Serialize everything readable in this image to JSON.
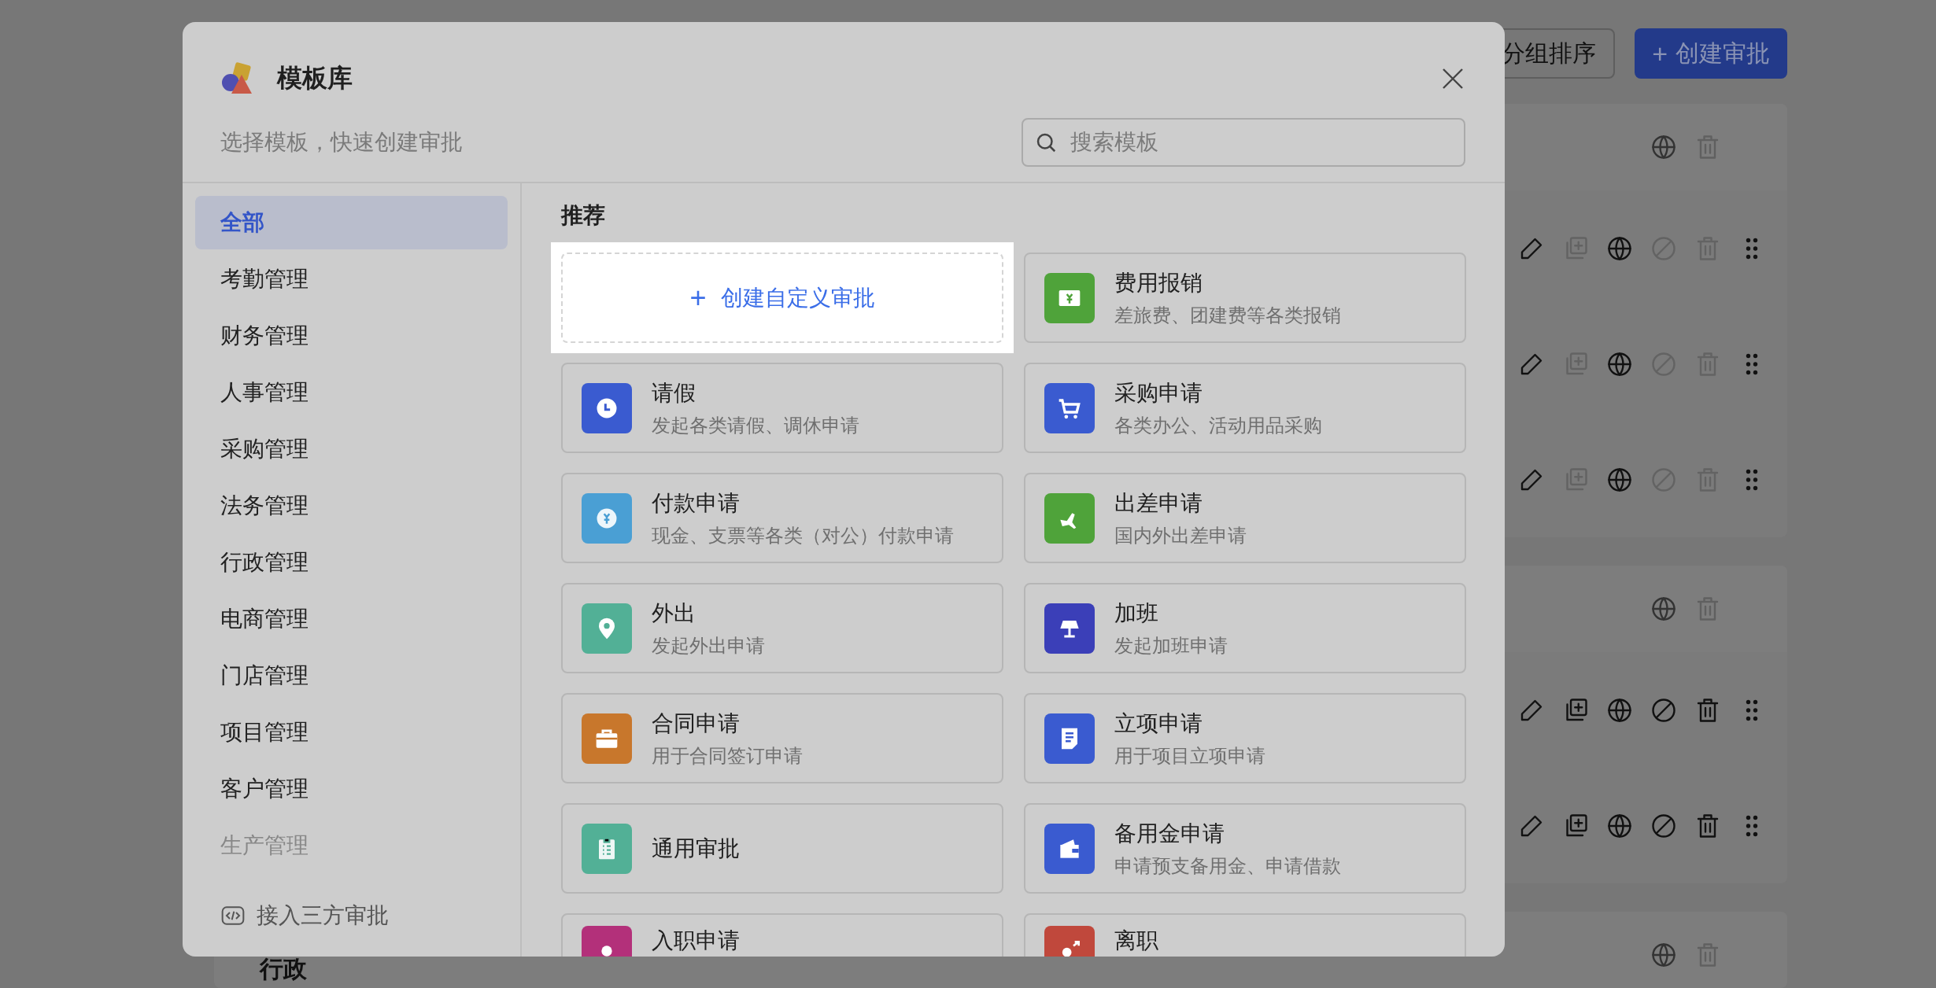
{
  "toolbar": [
    {
      "kind": "outline",
      "label": "分组排序"
    },
    {
      "kind": "primary",
      "icon": "+",
      "label": "创建审批"
    }
  ],
  "groups": [
    {
      "delete_disabled": true,
      "rows": [
        {
          "disabled": true
        },
        {
          "disabled": true
        },
        {
          "disabled": true
        }
      ]
    },
    {
      "delete_disabled": true,
      "rows": [
        {
          "disabled": false
        },
        {
          "disabled": false
        }
      ]
    },
    {
      "title": "行政",
      "delete_disabled": true
    }
  ],
  "modal": {
    "title": "模板库",
    "subtitle": "选择模板，快速创建审批",
    "search": {
      "placeholder": "搜索模板"
    },
    "sidebar": {
      "items": [
        {
          "label": "全部",
          "selected": true,
          "disabled": false
        },
        {
          "label": "考勤管理",
          "selected": false,
          "disabled": false
        },
        {
          "label": "财务管理",
          "selected": false,
          "disabled": false
        },
        {
          "label": "人事管理",
          "selected": false,
          "disabled": false
        },
        {
          "label": "采购管理",
          "selected": false,
          "disabled": false
        },
        {
          "label": "法务管理",
          "selected": false,
          "disabled": false
        },
        {
          "label": "行政管理",
          "selected": false,
          "disabled": false
        },
        {
          "label": "电商管理",
          "selected": false,
          "disabled": false
        },
        {
          "label": "门店管理",
          "selected": false,
          "disabled": false
        },
        {
          "label": "项目管理",
          "selected": false,
          "disabled": false
        },
        {
          "label": "客户管理",
          "selected": false,
          "disabled": false
        },
        {
          "label": "生产管理",
          "selected": false,
          "disabled": true
        }
      ],
      "footer": "接入三方审批"
    },
    "section": "推荐",
    "templates": [
      {
        "kind": "create",
        "icon": "+",
        "title": "创建自定义审批",
        "highlighted": true
      },
      {
        "kind": "money",
        "color": "#4fa33a",
        "title": "费用报销",
        "desc": "差旅费、团建费等各类报销"
      },
      {
        "kind": "clock",
        "color": "#3a5bd0",
        "title": "请假",
        "desc": "发起各类请假、调休申请"
      },
      {
        "kind": "cart",
        "color": "#3a5bd0",
        "title": "采购申请",
        "desc": "各类办公、活动用品采购"
      },
      {
        "kind": "coin",
        "color": "#4a9fd4",
        "title": "付款申请",
        "desc": "现金、支票等各类（对公）付款申请"
      },
      {
        "kind": "plane",
        "color": "#4fa33a",
        "title": "出差申请",
        "desc": "国内外出差申请"
      },
      {
        "kind": "pin",
        "color": "#52b096",
        "title": "外出",
        "desc": "发起外出申请"
      },
      {
        "kind": "lamp",
        "color": "#3b3fb8",
        "title": "加班",
        "desc": "发起加班申请"
      },
      {
        "kind": "briefcase",
        "color": "#c8772c",
        "title": "合同申请",
        "desc": "用于合同签订申请"
      },
      {
        "kind": "document",
        "color": "#3a5bd0",
        "title": "立项申请",
        "desc": "用于项目立项申请"
      },
      {
        "kind": "clipboard",
        "color": "#52b096",
        "title": "通用审批"
      },
      {
        "kind": "wallet",
        "color": "#3a5bd0",
        "title": "备用金申请",
        "desc": "申请预支备用金、申请借款"
      },
      {
        "kind": "person",
        "color": "#b3307a",
        "title": "入职申请"
      },
      {
        "kind": "exit",
        "color": "#c0483c",
        "title": "离职"
      }
    ]
  }
}
